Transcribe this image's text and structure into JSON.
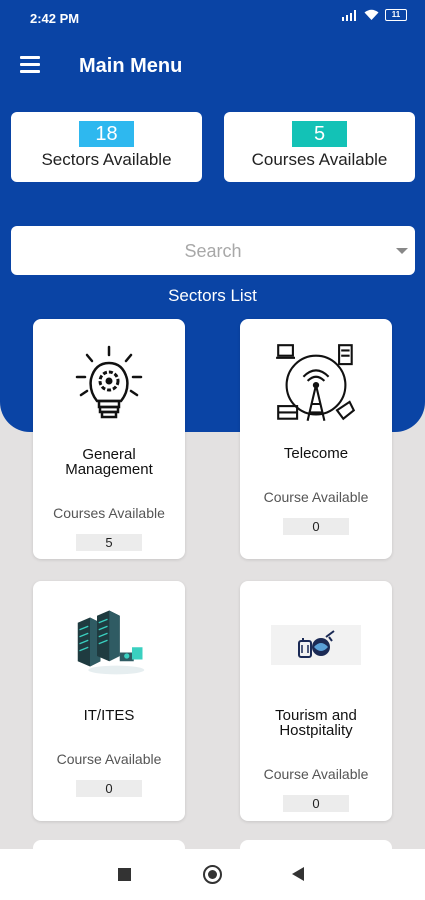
{
  "status_bar": {
    "time": "2:42 PM",
    "battery": "11"
  },
  "app_bar": {
    "title": "Main Menu"
  },
  "stats": {
    "sectors": {
      "value": "18",
      "label": "Sectors Available"
    },
    "courses": {
      "value": "5",
      "label": "Courses Available"
    }
  },
  "search": {
    "placeholder": "Search"
  },
  "sectors_list_title": "Sectors List",
  "sectors": [
    {
      "name": "General\nManagement",
      "sub": "Courses Available",
      "count": "5",
      "icon": "lightbulb-gear-icon"
    },
    {
      "name": "Telecome",
      "sub": "Course Available",
      "count": "0",
      "icon": "telecom-tower-icon"
    },
    {
      "name": "IT/ITES",
      "sub": "Course Available",
      "count": "0",
      "icon": "server-rack-icon"
    },
    {
      "name": "Tourism and\nHostpitality",
      "sub": "Course Available",
      "count": "0",
      "icon": "travel-icon"
    }
  ],
  "colors": {
    "primary": "#0a44a5",
    "sectors_badge": "#2eb8ef",
    "courses_badge": "#13c2b6",
    "background": "#e3e1e1"
  }
}
